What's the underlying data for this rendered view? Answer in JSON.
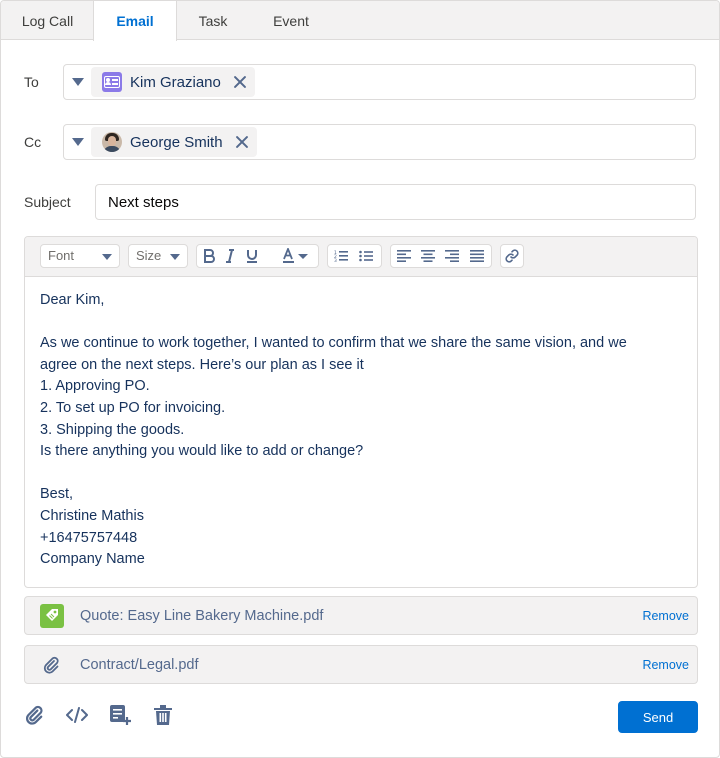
{
  "tabs": [
    {
      "label": "Log Call"
    },
    {
      "label": "Email"
    },
    {
      "label": "Task"
    },
    {
      "label": "Event"
    }
  ],
  "active_tab": "Email",
  "to": {
    "label": "To",
    "recipient": "Kim Graziano",
    "icon": "contact-card-icon"
  },
  "cc": {
    "label": "Cc",
    "recipient": "George Smith",
    "icon": "avatar"
  },
  "subject": {
    "label": "Subject",
    "value": "Next steps"
  },
  "toolbar": {
    "font_label": "Font",
    "size_label": "Size"
  },
  "body_lines": [
    "Dear Kim,",
    "",
    "As we continue to work together, I wanted to confirm that we share the same vision, and we",
    "agree on the next steps. Here’s our plan as I see it",
    "1. Approving PO.",
    "2. To set up PO for invoicing.",
    "3. Shipping the goods.",
    "Is there anything you would like to add or change?",
    "",
    "Best,",
    "Christine Mathis",
    "+16475757448",
    "Company Name"
  ],
  "attachments": [
    {
      "name": "Quote: Easy Line Bakery Machine.pdf",
      "remove_label": "Remove",
      "icon": "quote-icon"
    },
    {
      "name": "Contract/Legal.pdf",
      "remove_label": "Remove",
      "icon": "paperclip-icon"
    }
  ],
  "footer": {
    "send_label": "Send"
  },
  "colors": {
    "brand_blue": "#0070d2",
    "tab_bar": "#f3f2f2",
    "border": "#dddbda",
    "contact_icon": "#8b7ae8",
    "quote_icon": "#7ac143"
  }
}
